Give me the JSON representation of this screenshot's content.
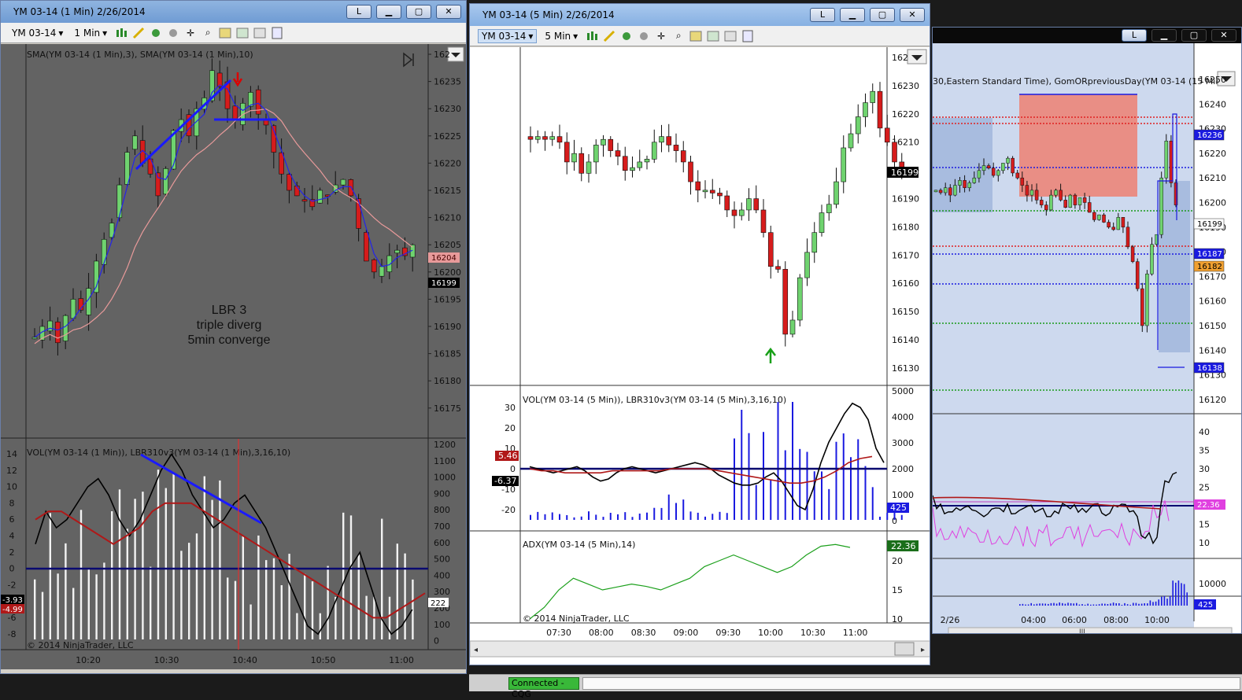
{
  "left_window": {
    "title": "YM 03-14 (1 Min)  2/26/2014",
    "instrument": "YM 03-14",
    "interval": "1 Min",
    "btn_l": "L",
    "price_pane_label": "SMA(YM 03-14 (1 Min),3), SMA(YM 03-14 (1 Min),10)",
    "indicator_pane_label": "VOL(YM 03-14 (1 Min)), LBR310v3(YM 03-14 (1 Min),3,16,10)",
    "annotation": [
      "LBR 3",
      "triple diverg",
      "5min converge"
    ],
    "price_ticks": [
      "162",
      "16235",
      "16230",
      "16225",
      "16220",
      "16215",
      "16210",
      "16205",
      "16200",
      "16195",
      "16190",
      "16185",
      "16180",
      "16175"
    ],
    "price_markers": {
      "sma10": "16204",
      "last": "16199"
    },
    "vol_ticks": [
      "1200",
      "1100",
      "1000",
      "900",
      "800",
      "700",
      "600",
      "500",
      "400",
      "300",
      "200",
      "100",
      "0"
    ],
    "osc_ticks": [
      "14",
      "12",
      "10",
      "8",
      "6",
      "4",
      "2",
      "0",
      "-2",
      "-4",
      "-6",
      "-8"
    ],
    "osc_markers": {
      "a": "-3.93",
      "b": "-4.99",
      "vol": "222"
    },
    "time_ticks": [
      "10:20",
      "10:30",
      "10:40",
      "10:50",
      "11:00"
    ],
    "copyright": "© 2014 NinjaTrader, LLC"
  },
  "mid_window": {
    "title": "YM 03-14 (5 Min)  2/26/2014",
    "instrument": "YM 03-14",
    "interval": "5 Min",
    "btn_l": "L",
    "price_ticks": [
      "162",
      "16230",
      "16220",
      "16210",
      "16200",
      "16190",
      "16180",
      "16170",
      "16160",
      "16150",
      "16140",
      "16130"
    ],
    "last_price": "16199",
    "vol_pane_label": "VOL(YM 03-14 (5 Min)), LBR310v3(YM 03-14 (5 Min),3,16,10)",
    "vol_ticks": [
      "5000",
      "4000",
      "3000",
      "2000",
      "1000",
      "0"
    ],
    "osc_ticks": [
      "30",
      "20",
      "10",
      "0",
      "-10",
      "-20"
    ],
    "osc_markers": {
      "a": "5.46",
      "b": "-6.37",
      "vol": "425"
    },
    "adx_label": "ADX(YM 03-14 (5 Min),14)",
    "adx_ticks": [
      "20",
      "15",
      "10"
    ],
    "adx_value": "22.36",
    "time_ticks": [
      "07:30",
      "08:00",
      "08:30",
      "09:00",
      "09:30",
      "10:00",
      "10:30",
      "11:00"
    ],
    "copyright": "© 2014 NinjaTrader, LLC"
  },
  "right_window": {
    "btn_l": "L",
    "pane_label": "30,Eastern Standard Time), GomORpreviousDay(YM 03-14 (15 Min",
    "price_ticks": [
      "16250",
      "16240",
      "16230",
      "16220",
      "16210",
      "16200",
      "16190",
      "16180",
      "16170",
      "16160",
      "16150",
      "16140",
      "16130",
      "16120"
    ],
    "markers": {
      "a": "16236",
      "b": "16199",
      "c": "16187",
      "d": "16182",
      "e": "16138"
    },
    "osc_ticks": [
      "40",
      "35",
      "30",
      "25",
      "20",
      "15",
      "10"
    ],
    "osc_value": "22.36",
    "vol_ticks": [
      "10000",
      "0"
    ],
    "vol_value": "425",
    "time_ticks": [
      "2/26",
      "04:00",
      "06:00",
      "08:00",
      "10:00"
    ],
    "scroll_grip": "III"
  },
  "status_bar": {
    "connection": "Connected - CQG"
  },
  "colors": {
    "up": "#6fd36f",
    "down": "#d61c1c",
    "sma3": "#2424e8",
    "sma10": "#e89a9a",
    "vol": "#1a1ae0"
  }
}
